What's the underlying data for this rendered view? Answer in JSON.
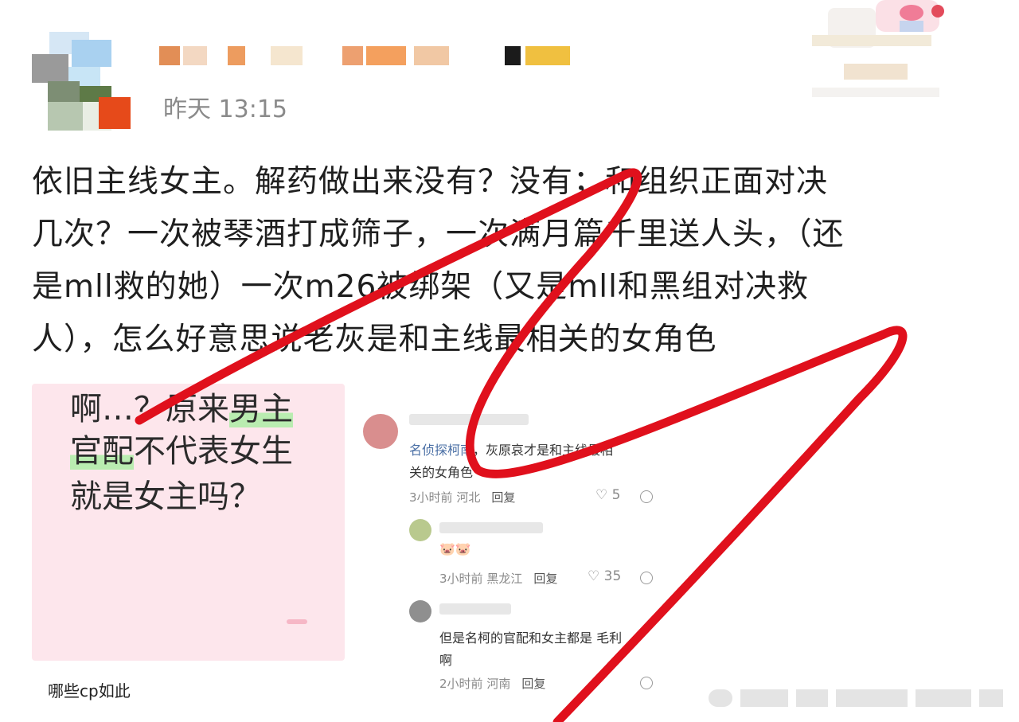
{
  "header": {
    "time": "昨天 13:15"
  },
  "post": {
    "lines": [
      "依旧主线女主。解药做出来没有？没有；和组织正面对决",
      "几次？一次被琴酒打成筛子，一次满月篇千里送人头，（还",
      "是mll救的她）一次m26被绑架（又是mll和黑组对决救",
      "人），怎么好意思说老灰是和主线最相关的女角色"
    ]
  },
  "left_card": {
    "line1_a": "啊…？原来",
    "line1_hl": "男主",
    "line2_hl": "官配",
    "line2_b": "不代表女生",
    "line3": "就是女主吗？",
    "caption": "哪些cp如此"
  },
  "comments": [
    {
      "name": "名侦探柯南",
      "text_a": "，灰原哀才是和主线最相",
      "text_b": "关的女角色",
      "time": "3小时前",
      "location": "河北",
      "reply": "回复",
      "likes": "5"
    },
    {
      "text_a": "🐷🐷",
      "time": "3小时前",
      "location": "黑龙江",
      "reply": "回复",
      "likes": "35"
    },
    {
      "text_a": "但是名柯的官配和女主都是 毛利",
      "text_b": "啊",
      "time": "2小时前",
      "location": "河南",
      "reply": "回复"
    }
  ],
  "colors": {
    "scribble": "#e0101c",
    "card_bg": "#fde6ec",
    "highlight": "#b9ecb0"
  }
}
